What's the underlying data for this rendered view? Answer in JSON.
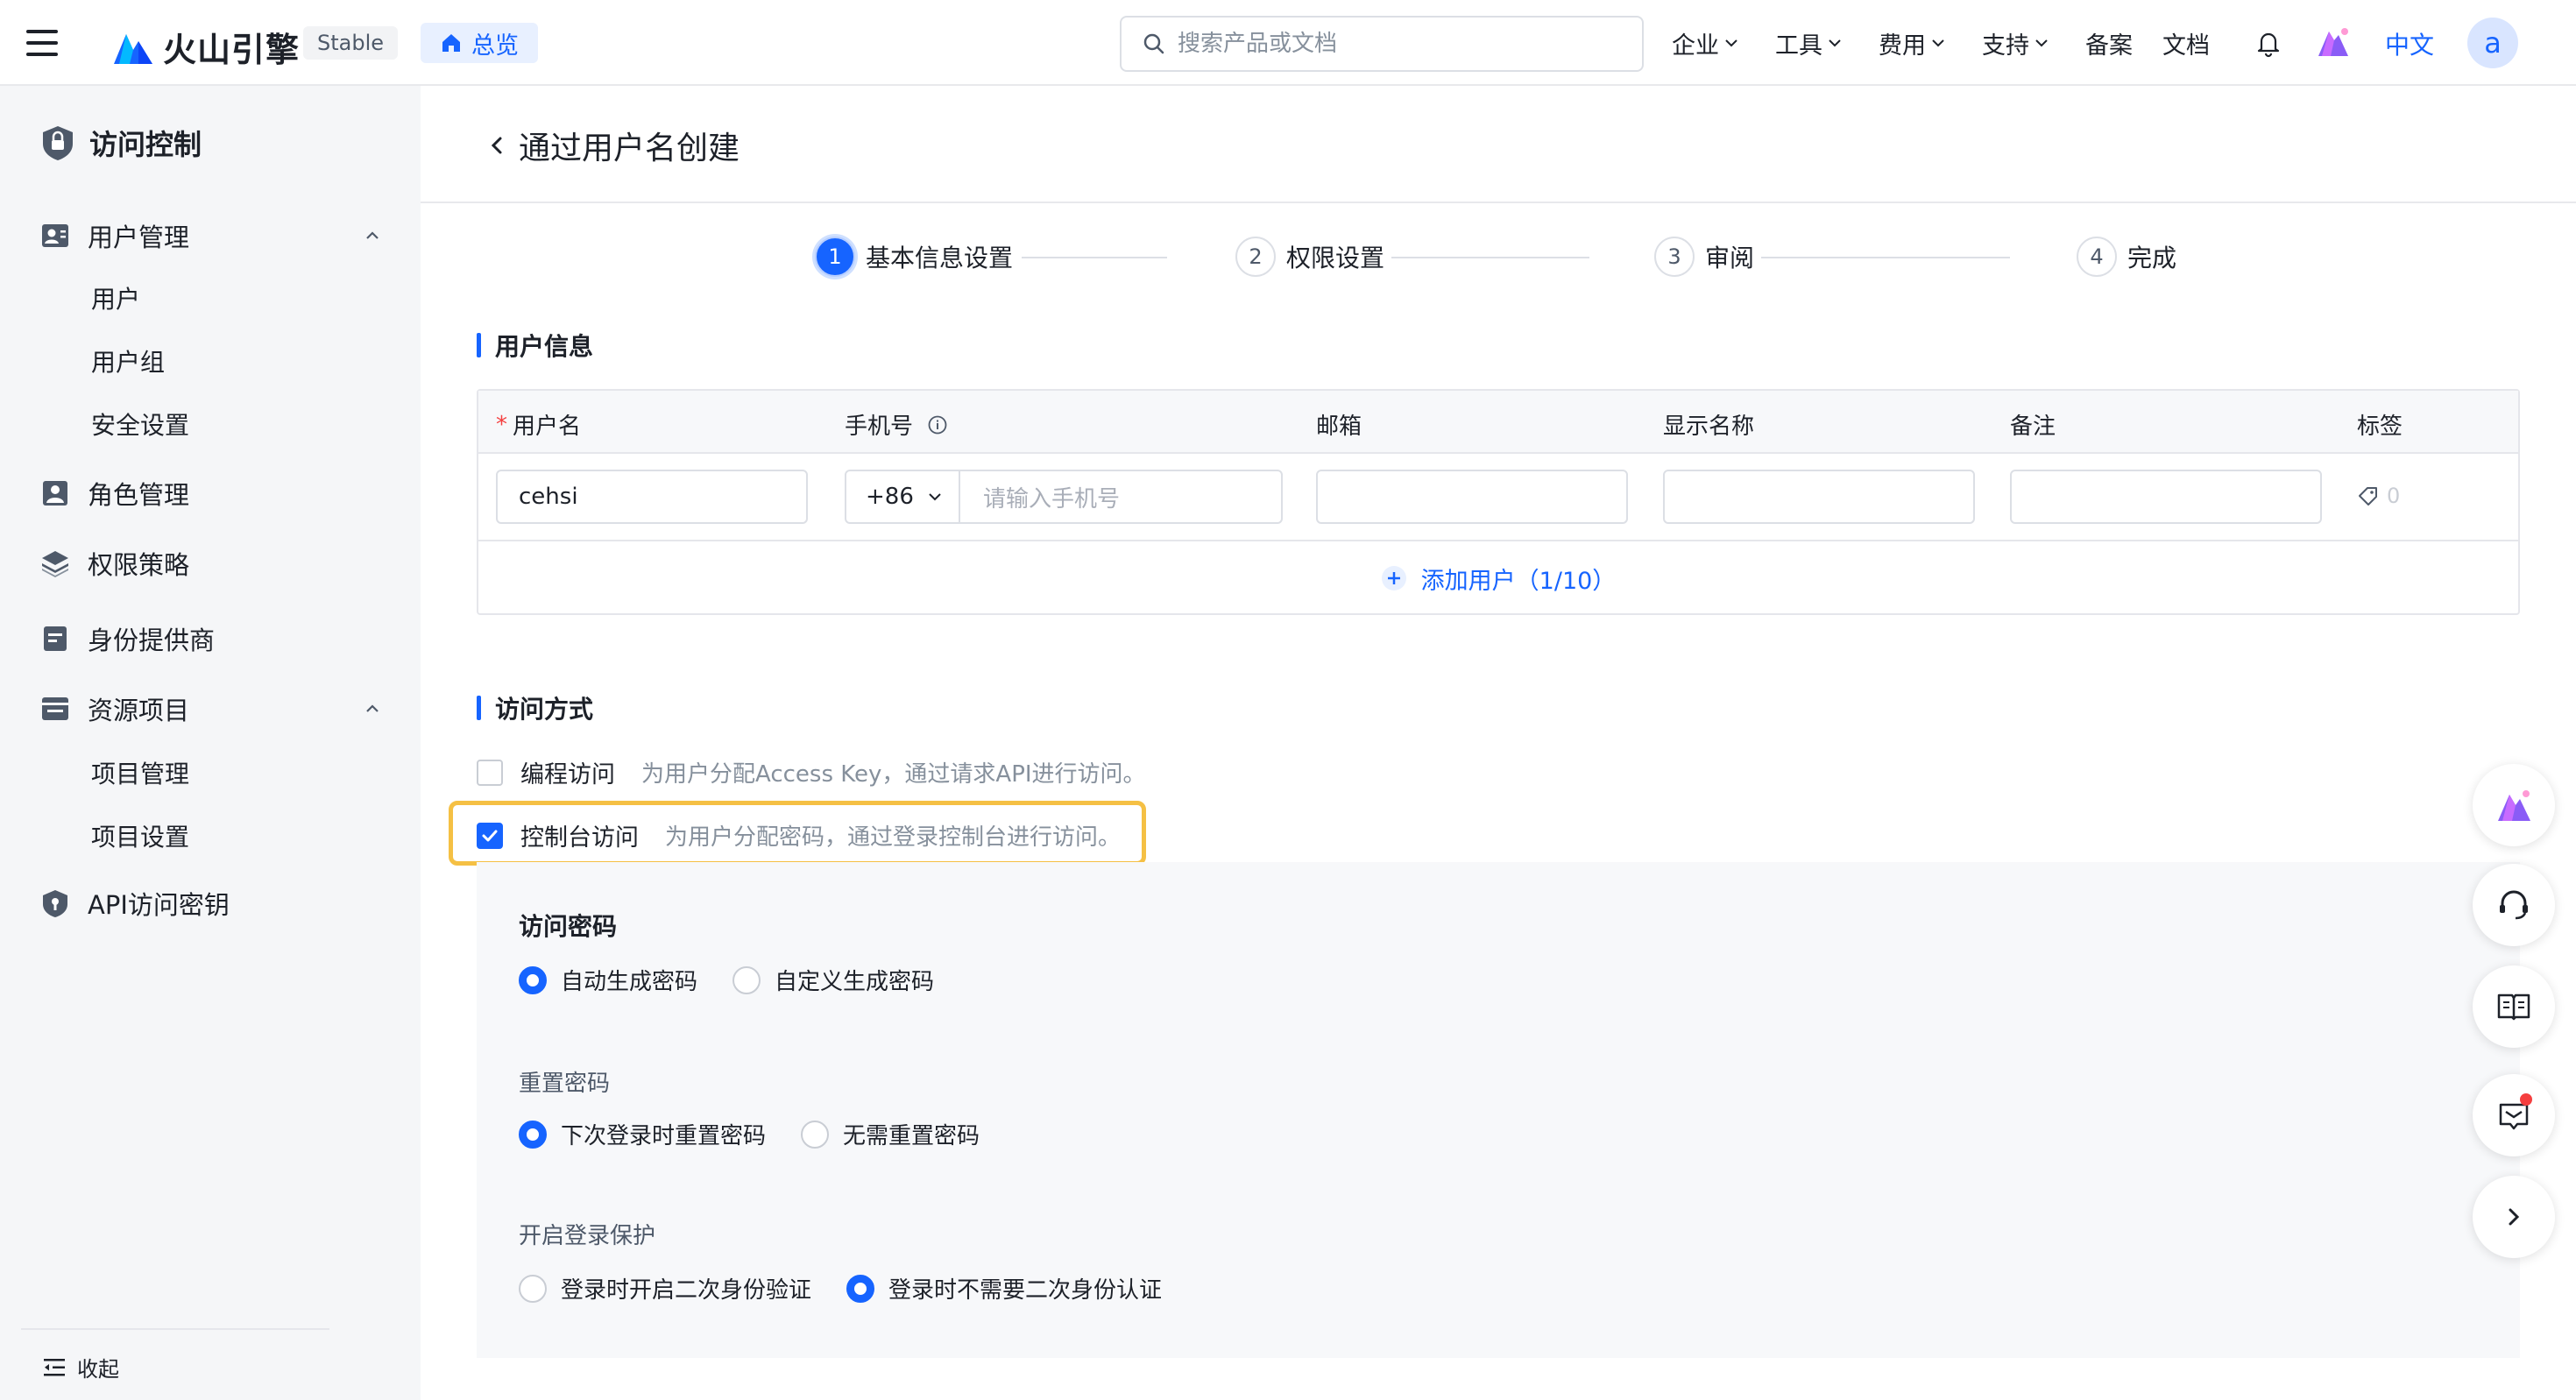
{
  "topbar": {
    "brand": "火山引擎",
    "version_badge": "Stable",
    "overview_tab": "总览",
    "search_placeholder": "搜索产品或文档",
    "nav": [
      {
        "label": "企业"
      },
      {
        "label": "工具"
      },
      {
        "label": "费用"
      },
      {
        "label": "支持"
      },
      {
        "label": "备案"
      },
      {
        "label": "文档"
      }
    ],
    "language": "中文",
    "avatar_letter": "a",
    "icons": [
      "menu-icon",
      "volcengine-logo",
      "home-icon",
      "search-icon",
      "chevron-down-icon",
      "bell-icon",
      "mascot-icon"
    ]
  },
  "sidebar": {
    "title": "访问控制",
    "groups": [
      {
        "label": "用户管理",
        "icon": "user-management-icon",
        "expanded": true,
        "items": [
          "用户",
          "用户组",
          "安全设置"
        ]
      },
      {
        "label": "角色管理",
        "icon": "role-icon"
      },
      {
        "label": "权限策略",
        "icon": "layers-icon"
      },
      {
        "label": "身份提供商",
        "icon": "identity-provider-icon"
      },
      {
        "label": "资源项目",
        "icon": "project-icon",
        "expanded": true,
        "items": [
          "项目管理",
          "项目设置"
        ]
      },
      {
        "label": "API访问密钥",
        "icon": "key-shield-icon"
      }
    ],
    "collapse_label": "收起"
  },
  "page": {
    "title": "通过用户名创建",
    "steps": [
      {
        "num": "1",
        "label": "基本信息设置",
        "active": true
      },
      {
        "num": "2",
        "label": "权限设置",
        "active": false
      },
      {
        "num": "3",
        "label": "审阅",
        "active": false
      },
      {
        "num": "4",
        "label": "完成",
        "active": false
      }
    ]
  },
  "user_info": {
    "section_title": "用户信息",
    "columns": {
      "required_mark": "*",
      "username": "用户名",
      "phone": "手机号",
      "email": "邮箱",
      "display_name": "显示名称",
      "remark": "备注",
      "tags": "标签"
    },
    "row": {
      "username": "cehsi",
      "phone_code": "+86",
      "phone_placeholder": "请输入手机号",
      "email": "",
      "display_name": "",
      "remark": "",
      "tag_count": "0"
    },
    "add_user_label": "添加用户（1/10）"
  },
  "access": {
    "section_title": "访问方式",
    "programmatic": {
      "label": "编程访问",
      "desc": "为用户分配Access Key，通过请求API进行访问。",
      "checked": false
    },
    "console": {
      "label": "控制台访问",
      "desc": "为用户分配密码，通过登录控制台进行访问。",
      "checked": true
    },
    "password": {
      "title": "访问密码",
      "options": [
        {
          "label": "自动生成密码",
          "selected": true
        },
        {
          "label": "自定义生成密码",
          "selected": false
        }
      ]
    },
    "reset": {
      "title": "重置密码",
      "options": [
        {
          "label": "下次登录时重置密码",
          "selected": true
        },
        {
          "label": "无需重置密码",
          "selected": false
        }
      ]
    },
    "mfa": {
      "title": "开启登录保护",
      "options": [
        {
          "label": "登录时开启二次身份验证",
          "selected": false
        },
        {
          "label": "登录时不需要二次身份认证",
          "selected": true
        }
      ]
    }
  },
  "colors": {
    "primary": "#1664ff",
    "highlight_border": "#f5c044",
    "sidebar_bg": "#f5f6f8",
    "required": "#f53f3f"
  }
}
